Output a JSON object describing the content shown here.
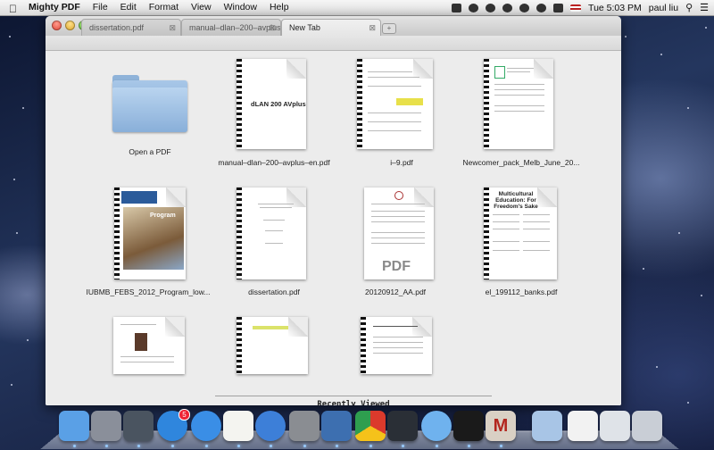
{
  "menubar": {
    "app_name": "Mighty PDF",
    "menus": [
      "File",
      "Edit",
      "Format",
      "View",
      "Window",
      "Help"
    ],
    "clock": "Tue 5:03 PM",
    "user": "paul liu"
  },
  "window": {
    "tabs": [
      {
        "label": "dissertation.pdf",
        "active": false
      },
      {
        "label": "manual–dlan–200–avplus–en...",
        "active": false
      },
      {
        "label": "New Tab",
        "active": true
      }
    ],
    "close_glyph": "⊠",
    "new_tab_glyph": "+"
  },
  "content": {
    "open_label": "Open a PDF",
    "files": [
      {
        "name": "manual–dlan–200–avplus–en.pdf",
        "cover_title": "dLAN  200 AVplus"
      },
      {
        "name": "i–9.pdf"
      },
      {
        "name": "Newcomer_pack_Melb_June_20..."
      },
      {
        "name": "IUBMB_FEBS_2012_Program_low...",
        "cover_title": "Program"
      },
      {
        "name": "dissertation.pdf"
      },
      {
        "name": "20120912_AA.pdf",
        "cover_title": "PDF"
      },
      {
        "name": "el_199112_banks.pdf",
        "cover_title": "Multicultural Education: For Freedom's Sake"
      },
      {
        "name": ""
      },
      {
        "name": ""
      },
      {
        "name": ""
      }
    ],
    "recent_label": "Recently Viewed"
  },
  "dock": {
    "items": [
      {
        "name": "finder-icon",
        "color": "#5aa0e6"
      },
      {
        "name": "launchpad-icon",
        "color": "#8a8f9a"
      },
      {
        "name": "mission-control-icon",
        "color": "#4a5460"
      },
      {
        "name": "app-store-icon",
        "color": "#2f86dd",
        "badge": "5"
      },
      {
        "name": "safari-icon",
        "color": "#3a8ee6"
      },
      {
        "name": "reminders-icon",
        "color": "#f4f4f0"
      },
      {
        "name": "itunes-icon",
        "color": "#3d7fd8"
      },
      {
        "name": "system-preferences-icon",
        "color": "#8a8d92"
      },
      {
        "name": "xcode-icon",
        "color": "#3d6fb0"
      },
      {
        "name": "chrome-icon",
        "color": "#e7e7e7"
      },
      {
        "name": "activity-monitor-icon",
        "color": "#2a2f36"
      },
      {
        "name": "messages-icon",
        "color": "#6fb2ee"
      },
      {
        "name": "terminal-icon",
        "color": "#1a1a1a"
      },
      {
        "name": "mighty-pdf-icon",
        "color": "#d9d0c4",
        "letter": "M"
      },
      {
        "name": "downloads-folder-icon",
        "color": "#a8c5e6"
      },
      {
        "name": "documents-stack-icon",
        "color": "#f2f2f2"
      },
      {
        "name": "screenshot-stack-icon",
        "color": "#dfe3e8"
      },
      {
        "name": "trash-icon",
        "color": "#c9ced6"
      }
    ]
  }
}
